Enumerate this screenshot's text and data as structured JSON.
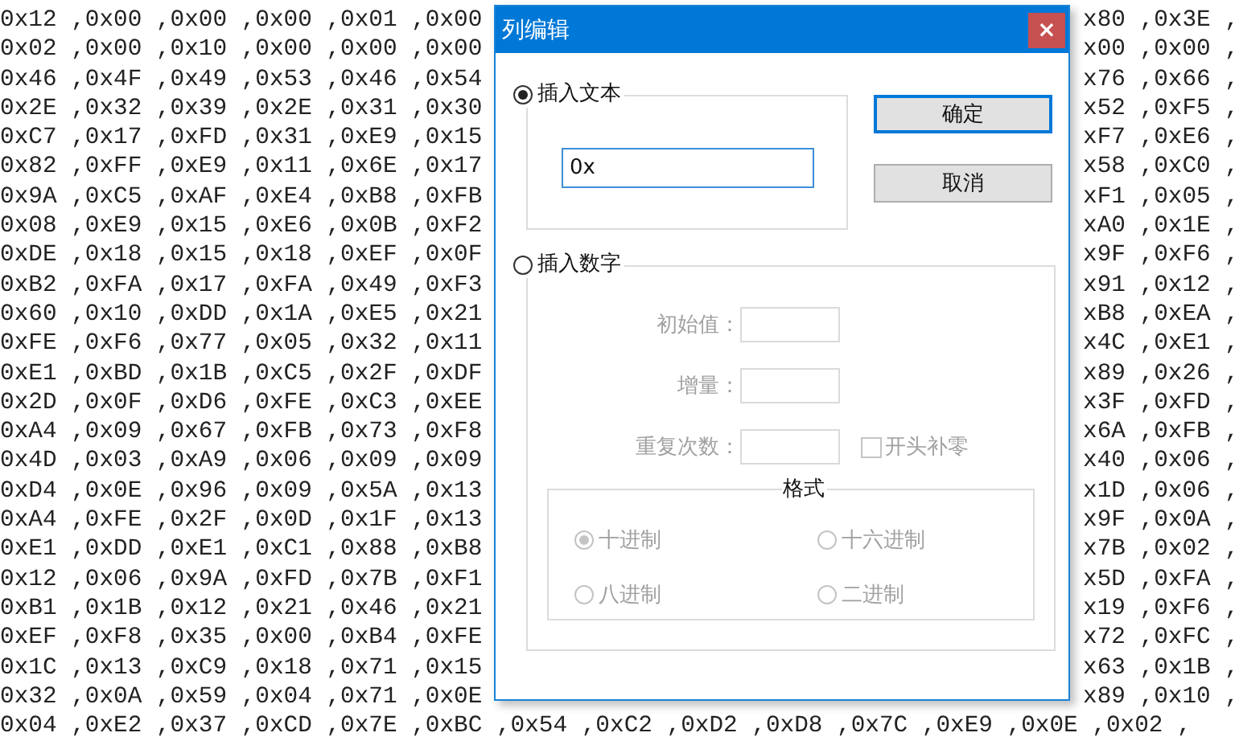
{
  "editor": {
    "rows": [
      {
        "left": "0x12 ,0x00 ,0x00 ,0x00 ,0x01 ,0x00",
        "right": "x80 ,0x3E ,"
      },
      {
        "left": "0x02 ,0x00 ,0x10 ,0x00 ,0x00 ,0x00",
        "right": "x00 ,0x00 ,"
      },
      {
        "left": "0x46 ,0x4F ,0x49 ,0x53 ,0x46 ,0x54",
        "right": "x76 ,0x66 ,"
      },
      {
        "left": "0x2E ,0x32 ,0x39 ,0x2E ,0x31 ,0x30",
        "right": "x52 ,0xF5 ,"
      },
      {
        "left": "0xC7 ,0x17 ,0xFD ,0x31 ,0xE9 ,0x15",
        "right": "xF7 ,0xE6 ,"
      },
      {
        "left": "0x82 ,0xFF ,0xE9 ,0x11 ,0x6E ,0x17",
        "right": "x58 ,0xC0 ,"
      },
      {
        "left": "0x9A ,0xC5 ,0xAF ,0xE4 ,0xB8 ,0xFB",
        "right": "xF1 ,0x05 ,"
      },
      {
        "left": "0x08 ,0xE9 ,0x15 ,0xE6 ,0x0B ,0xF2",
        "right": "xA0 ,0x1E ,"
      },
      {
        "left": "0xDE ,0x18 ,0x15 ,0x18 ,0xEF ,0x0F",
        "right": "x9F ,0xF6 ,"
      },
      {
        "left": "0xB2 ,0xFA ,0x17 ,0xFA ,0x49 ,0xF3",
        "right": "x91 ,0x12 ,"
      },
      {
        "left": "0x60 ,0x10 ,0xDD ,0x1A ,0xE5 ,0x21",
        "right": "xB8 ,0xEA ,"
      },
      {
        "left": "0xFE ,0xF6 ,0x77 ,0x05 ,0x32 ,0x11",
        "right": "x4C ,0xE1 ,"
      },
      {
        "left": "0xE1 ,0xBD ,0x1B ,0xC5 ,0x2F ,0xDF",
        "right": "x89 ,0x26 ,"
      },
      {
        "left": "0x2D ,0x0F ,0xD6 ,0xFE ,0xC3 ,0xEE",
        "right": "x3F ,0xFD ,"
      },
      {
        "left": "0xA4 ,0x09 ,0x67 ,0xFB ,0x73 ,0xF8",
        "right": "x6A ,0xFB ,"
      },
      {
        "left": "0x4D ,0x03 ,0xA9 ,0x06 ,0x09 ,0x09",
        "right": "x40 ,0x06 ,"
      },
      {
        "left": "0xD4 ,0x0E ,0x96 ,0x09 ,0x5A ,0x13",
        "right": "x1D ,0x06 ,"
      },
      {
        "left": "0xA4 ,0xFE ,0x2F ,0x0D ,0x1F ,0x13",
        "right": "x9F ,0x0A ,"
      },
      {
        "left": "0xE1 ,0xDD ,0xE1 ,0xC1 ,0x88 ,0xB8",
        "right": "x7B ,0x02 ,"
      },
      {
        "left": "0x12 ,0x06 ,0x9A ,0xFD ,0x7B ,0xF1",
        "right": "x5D ,0xFA ,"
      },
      {
        "left": "0xB1 ,0x1B ,0x12 ,0x21 ,0x46 ,0x21",
        "right": "x19 ,0xF6 ,"
      },
      {
        "left": "0xEF ,0xF8 ,0x35 ,0x00 ,0xB4 ,0xFE",
        "right": "x72 ,0xFC ,"
      },
      {
        "left": "0x1C ,0x13 ,0xC9 ,0x18 ,0x71 ,0x15",
        "right": "x63 ,0x1B ,"
      },
      {
        "left": "0x32 ,0x0A ,0x59 ,0x04 ,0x71 ,0x0E",
        "right": "x89 ,0x10 ,"
      }
    ],
    "last_row": "0x04 ,0xE2 ,0x37 ,0xCD ,0x7E ,0xBC ,0x54 ,0xC2 ,0xD2 ,0xD8 ,0x7C ,0xE9 ,0x0E ,0x02 ,"
  },
  "dialog": {
    "title": "列编辑",
    "close": "×",
    "insert_text": {
      "label": "插入文本",
      "selected": true,
      "value": "0x"
    },
    "insert_number": {
      "label": "插入数字",
      "selected": false,
      "disabled": true,
      "fields": [
        {
          "label": "初始值："
        },
        {
          "label": "增量："
        },
        {
          "label": "重复次数："
        }
      ],
      "pad_zero": {
        "label": "开头补零",
        "checked": false
      },
      "format": {
        "title": "格式",
        "options": [
          {
            "label": "十进制",
            "selected": true
          },
          {
            "label": "十六进制",
            "selected": false
          },
          {
            "label": "八进制",
            "selected": false
          },
          {
            "label": "二进制",
            "selected": false
          }
        ]
      }
    },
    "buttons": [
      {
        "label": "确定",
        "focused": true
      },
      {
        "label": "取消",
        "focused": false
      }
    ]
  }
}
